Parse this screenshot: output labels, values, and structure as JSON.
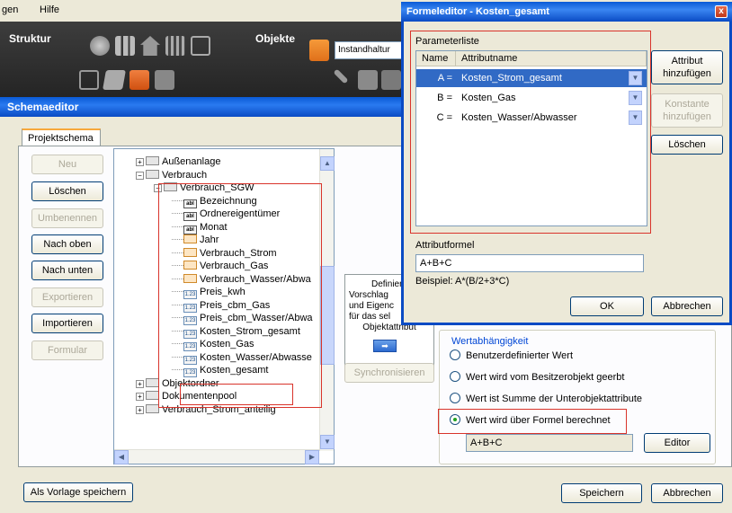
{
  "menubar": {
    "items": [
      "gen",
      "Hilfe"
    ]
  },
  "toolbar": {
    "struktur_label": "Struktur",
    "objekte_label": "Objekte",
    "combo_value": "Instandhaltur"
  },
  "schema": {
    "title": "Schemaeditor",
    "tab": "Projektschema",
    "buttons": {
      "neu": "Neu",
      "loeschen": "Löschen",
      "umbenennen": "Umbenennen",
      "nach_oben": "Nach oben",
      "nach_unten": "Nach unten",
      "exportieren": "Exportieren",
      "importieren": "Importieren",
      "formular": "Formular"
    },
    "tree": [
      {
        "label": "Außenanlage",
        "icon": "folder-icon",
        "exp": "+"
      },
      {
        "label": "Verbrauch",
        "icon": "folder-icon",
        "exp": "-"
      },
      {
        "label": "Verbrauch_SGW",
        "icon": "folder-icon",
        "exp": "-"
      },
      {
        "label": "Bezeichnung",
        "icon": "abl",
        "exp": ""
      },
      {
        "label": "Ordnereigentümer",
        "icon": "abl",
        "exp": ""
      },
      {
        "label": "Monat",
        "icon": "abl",
        "exp": ""
      },
      {
        "label": "Jahr",
        "icon": "obj",
        "exp": ""
      },
      {
        "label": "Verbrauch_Strom",
        "icon": "obj",
        "exp": ""
      },
      {
        "label": "Verbrauch_Gas",
        "icon": "obj",
        "exp": ""
      },
      {
        "label": "Verbrauch_Wasser/Abwa",
        "icon": "obj",
        "exp": ""
      },
      {
        "label": "Preis_kwh",
        "icon": "1.23",
        "exp": ""
      },
      {
        "label": "Preis_cbm_Gas",
        "icon": "1.23",
        "exp": ""
      },
      {
        "label": "Preis_cbm_Wasser/Abwa",
        "icon": "1.23",
        "exp": ""
      },
      {
        "label": "Kosten_Strom_gesamt",
        "icon": "1.23",
        "exp": ""
      },
      {
        "label": "Kosten_Gas",
        "icon": "1.23",
        "exp": ""
      },
      {
        "label": "Kosten_Wasser/Abwasse",
        "icon": "1.23",
        "exp": ""
      },
      {
        "label": "Kosten_gesamt",
        "icon": "1.23",
        "exp": ""
      },
      {
        "label": "Objektordner",
        "icon": "folder-icon",
        "exp": "+"
      },
      {
        "label": "Dokumentenpool",
        "icon": "folder-icon",
        "exp": "+"
      },
      {
        "label": "Verbrauch_Strom_anteilig",
        "icon": "folder-icon",
        "exp": "+"
      }
    ],
    "hint_lines": [
      "Definiere",
      "Vorschlag",
      "und Eigenc",
      "für das sel",
      "Objektattribut"
    ],
    "synchronisieren": "Synchronisieren",
    "wertabhaengigkeit": {
      "legend": "Wertabhängigkeit",
      "options": [
        "Benutzerdefinierter Wert",
        "Wert wird vom Besitzerobjekt geerbt",
        "Wert ist Summe der Unterobjektattribute",
        "Wert wird über Formel berechnet"
      ],
      "selected_index": 3,
      "formula_value": "A+B+C",
      "editor_button": "Editor"
    },
    "als_vorlage": "Als Vorlage speichern",
    "speichern": "Speichern",
    "abbrechen": "Abbrechen"
  },
  "formeleditor": {
    "title": "Formeleditor - Kosten_gesamt",
    "close": "x",
    "parameterliste_label": "Parameterliste",
    "columns": [
      "Name",
      "Attributname"
    ],
    "rows": [
      {
        "name": "A =",
        "attribute": "Kosten_Strom_gesamt",
        "selected": true
      },
      {
        "name": "B =",
        "attribute": "Kosten_Gas",
        "selected": false
      },
      {
        "name": "C =",
        "attribute": "Kosten_Wasser/Abwasser",
        "selected": false
      }
    ],
    "attribut_hinzufuegen": [
      "Attribut",
      "hinzufügen"
    ],
    "konstante_hinzufuegen": [
      "Konstante",
      "hinzufügen"
    ],
    "loeschen": "Löschen",
    "attributformel_label": "Attributformel",
    "formula": "A+B+C",
    "beispiel": "Beispiel:  A*(B/2+3*C)",
    "ok": "OK",
    "abbrechen": "Abbrechen"
  },
  "colors": {
    "accent": "#0a4bc4",
    "highlight": "#d9342b",
    "selection": "#316ac5"
  }
}
